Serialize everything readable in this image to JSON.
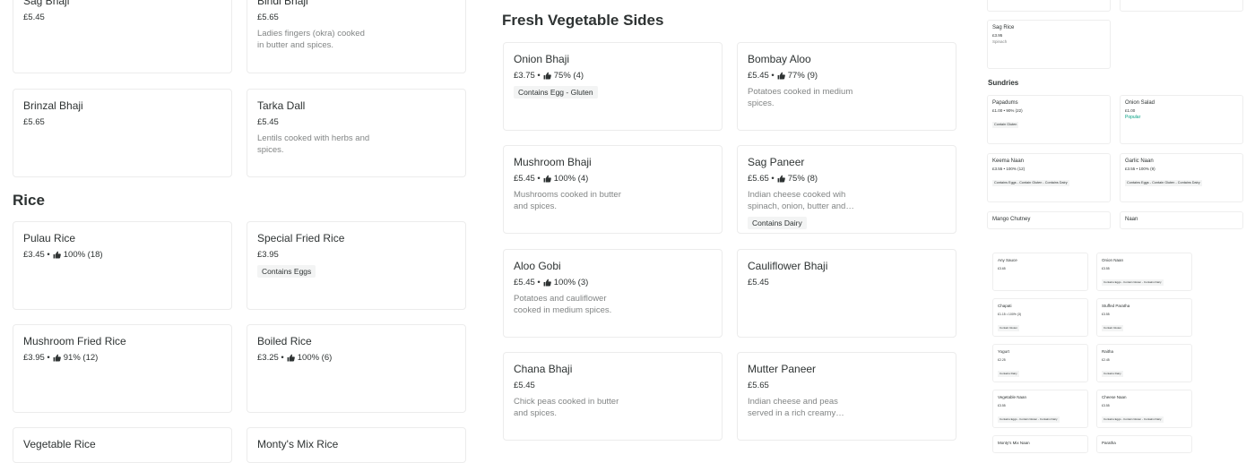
{
  "sections": {
    "rice_title": "Rice",
    "veg_title": "Fresh Vegetable Sides",
    "sundries_title": "Sundries"
  },
  "left_cards": [
    {
      "name": "Sag Bhaji",
      "meta": "£5.45",
      "rating": "",
      "desc": "",
      "tag": ""
    },
    {
      "name": "Bindi Bhaji",
      "meta": "£5.65",
      "rating": "",
      "desc": "Ladies fingers (okra) cooked in butter and spices.",
      "tag": ""
    },
    {
      "name": "Brinzal Bhaji",
      "meta": "£5.65",
      "rating": "",
      "desc": "",
      "tag": ""
    },
    {
      "name": "Tarka Dall",
      "meta": "£5.45",
      "rating": "",
      "desc": "Lentils cooked with herbs and spices.",
      "tag": ""
    },
    {
      "name": "Pulau Rice",
      "meta": "£3.45 •",
      "rating": "100% (18)",
      "desc": "",
      "tag": ""
    },
    {
      "name": "Special Fried Rice",
      "meta": "£3.95",
      "rating": "",
      "desc": "",
      "tag": "Contains Eggs"
    },
    {
      "name": "Mushroom Fried Rice",
      "meta": "£3.95 •",
      "rating": "91% (12)",
      "desc": "",
      "tag": ""
    },
    {
      "name": "Boiled Rice",
      "meta": "£3.25 •",
      "rating": "100% (6)",
      "desc": "",
      "tag": ""
    },
    {
      "name": "Vegetable Rice",
      "meta": "",
      "rating": "",
      "desc": "",
      "tag": ""
    },
    {
      "name": "Monty's Mix Rice",
      "meta": "",
      "rating": "",
      "desc": "",
      "tag": ""
    }
  ],
  "veg_cards": [
    {
      "name": "Onion Bhaji",
      "meta": "£3.75 •",
      "rating": "75% (4)",
      "desc": "",
      "tag": "Contains Egg - Gluten"
    },
    {
      "name": "Bombay Aloo",
      "meta": "£5.45 •",
      "rating": "77% (9)",
      "desc": "Potatoes cooked in medium spices.",
      "tag": ""
    },
    {
      "name": "Mushroom Bhaji",
      "meta": "£5.45 •",
      "rating": "100% (4)",
      "desc": "Mushrooms cooked in butter and spices.",
      "tag": ""
    },
    {
      "name": "Sag Paneer",
      "meta": "£5.65 •",
      "rating": "75% (8)",
      "desc": "Indian cheese cooked wih spinach, onion, butter and…",
      "tag": "Contains Dairy"
    },
    {
      "name": "Aloo Gobi",
      "meta": "£5.45 •",
      "rating": "100% (3)",
      "desc": "Potatoes and cauliflower cooked in medium spices.",
      "tag": ""
    },
    {
      "name": "Cauliflower Bhaji",
      "meta": "£5.45",
      "rating": "",
      "desc": "",
      "tag": ""
    },
    {
      "name": "Chana Bhaji",
      "meta": "£5.45",
      "rating": "",
      "desc": "Chick peas cooked in butter and spices.",
      "tag": ""
    },
    {
      "name": "Mutter Paneer",
      "meta": "£5.65",
      "rating": "",
      "desc": "Indian cheese and peas served in a rich creamy…",
      "tag": ""
    }
  ],
  "mini_top": [
    {
      "name": "Sag Rice",
      "meta": "£3.95",
      "desc": "Spinach"
    }
  ],
  "mini_cards": [
    {
      "name": "Papadums",
      "meta": "£1.00 • 90% (22)",
      "tag": "Contain Gluten",
      "pop": ""
    },
    {
      "name": "Onion Salad",
      "meta": "£1.00",
      "tag": "",
      "pop": "Popular"
    },
    {
      "name": "Keema Naan",
      "meta": "£3.55 • 100% (12)",
      "tag": "Contains Eggs - Contain Gluten - Contains Dairy",
      "pop": ""
    },
    {
      "name": "Garlic Naan",
      "meta": "£3.55 • 100% (9)",
      "tag": "Contains Eggs - Contain Gluten - Contains Dairy",
      "pop": ""
    },
    {
      "name": "Mango Chutney",
      "meta": "",
      "tag": "",
      "pop": ""
    },
    {
      "name": "Naan",
      "meta": "",
      "tag": "",
      "pop": ""
    }
  ],
  "tiny_cards": [
    {
      "name": "Any Sauce",
      "meta": "£3.65",
      "tag": ""
    },
    {
      "name": "Onion Naan",
      "meta": "£3.55",
      "tag": "Contains Eggs - Contain Gluten - Contains Dairy"
    },
    {
      "name": "Chapati",
      "meta": "£1.15 • 100% (3)",
      "tag": "Contain Gluten"
    },
    {
      "name": "Stuffed Paratha",
      "meta": "£3.55",
      "tag": "Contain Gluten"
    },
    {
      "name": "Yogurt",
      "meta": "£2.25",
      "tag": "Contains Dairy"
    },
    {
      "name": "Raitha",
      "meta": "£2.45",
      "tag": "Contains Dairy"
    },
    {
      "name": "Vegetable Naan",
      "meta": "£3.55",
      "tag": "Contains Eggs - Contain Gluten - Contains Dairy"
    },
    {
      "name": "Cheese Naan",
      "meta": "£3.55",
      "tag": "Contains Eggs - Contain Gluten - Contains Dairy"
    },
    {
      "name": "Monty's Mix Naan",
      "meta": "",
      "tag": ""
    },
    {
      "name": "Paratha",
      "meta": "",
      "tag": ""
    }
  ]
}
